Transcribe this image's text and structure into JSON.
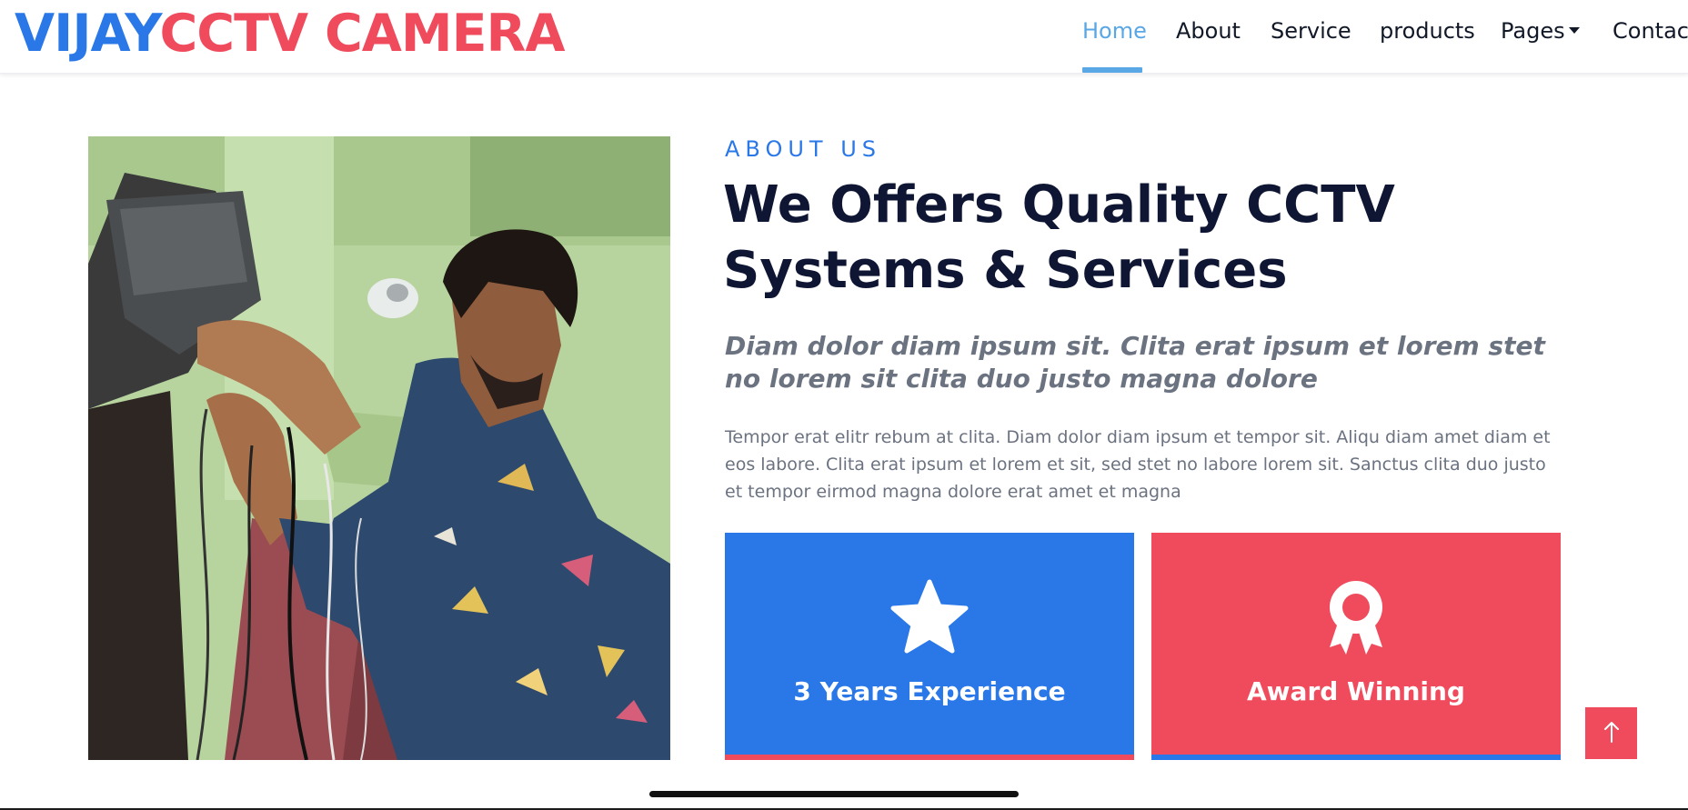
{
  "brand": {
    "part1": "VIJAY",
    "part2": "CCTV CAMERA",
    "colors": {
      "part1": "#2a78e8",
      "part2": "#f04b5c"
    }
  },
  "nav": {
    "items": [
      {
        "label": "Home",
        "active": true
      },
      {
        "label": "About",
        "active": false
      },
      {
        "label": "Service",
        "active": false
      },
      {
        "label": "products",
        "active": false
      },
      {
        "label": "Pages",
        "active": false,
        "dropdown": true
      },
      {
        "label": "Contact",
        "active": false
      }
    ],
    "active_color": "#5aa7e6"
  },
  "about": {
    "eyebrow": "ABOUT US",
    "title_line1": "We Offers Quality CCTV",
    "title_line2": "Systems & Services",
    "subtitle": "Diam dolor diam ipsum sit. Clita erat ipsum et lorem stet no lorem sit clita duo justo magna dolore",
    "body": "Tempor erat elitr rebum at clita. Diam dolor diam ipsum et tempor sit. Aliqu diam amet diam et eos labore. Clita erat ipsum et lorem et sit, sed stet no labore lorem sit. Sanctus clita duo justo et tempor eirmod magna dolore erat amet et magna"
  },
  "cards": [
    {
      "label": "3 Years Experience",
      "icon": "star-icon",
      "color": "#2a78e8"
    },
    {
      "label": "Award Winning",
      "icon": "award-ribbon-icon",
      "color": "#f04b5c"
    }
  ],
  "back_to_top": {
    "icon": "arrow-up-icon",
    "color": "#f04b5c"
  },
  "photo": {
    "subject": "technician-installing-cctv-photo"
  }
}
